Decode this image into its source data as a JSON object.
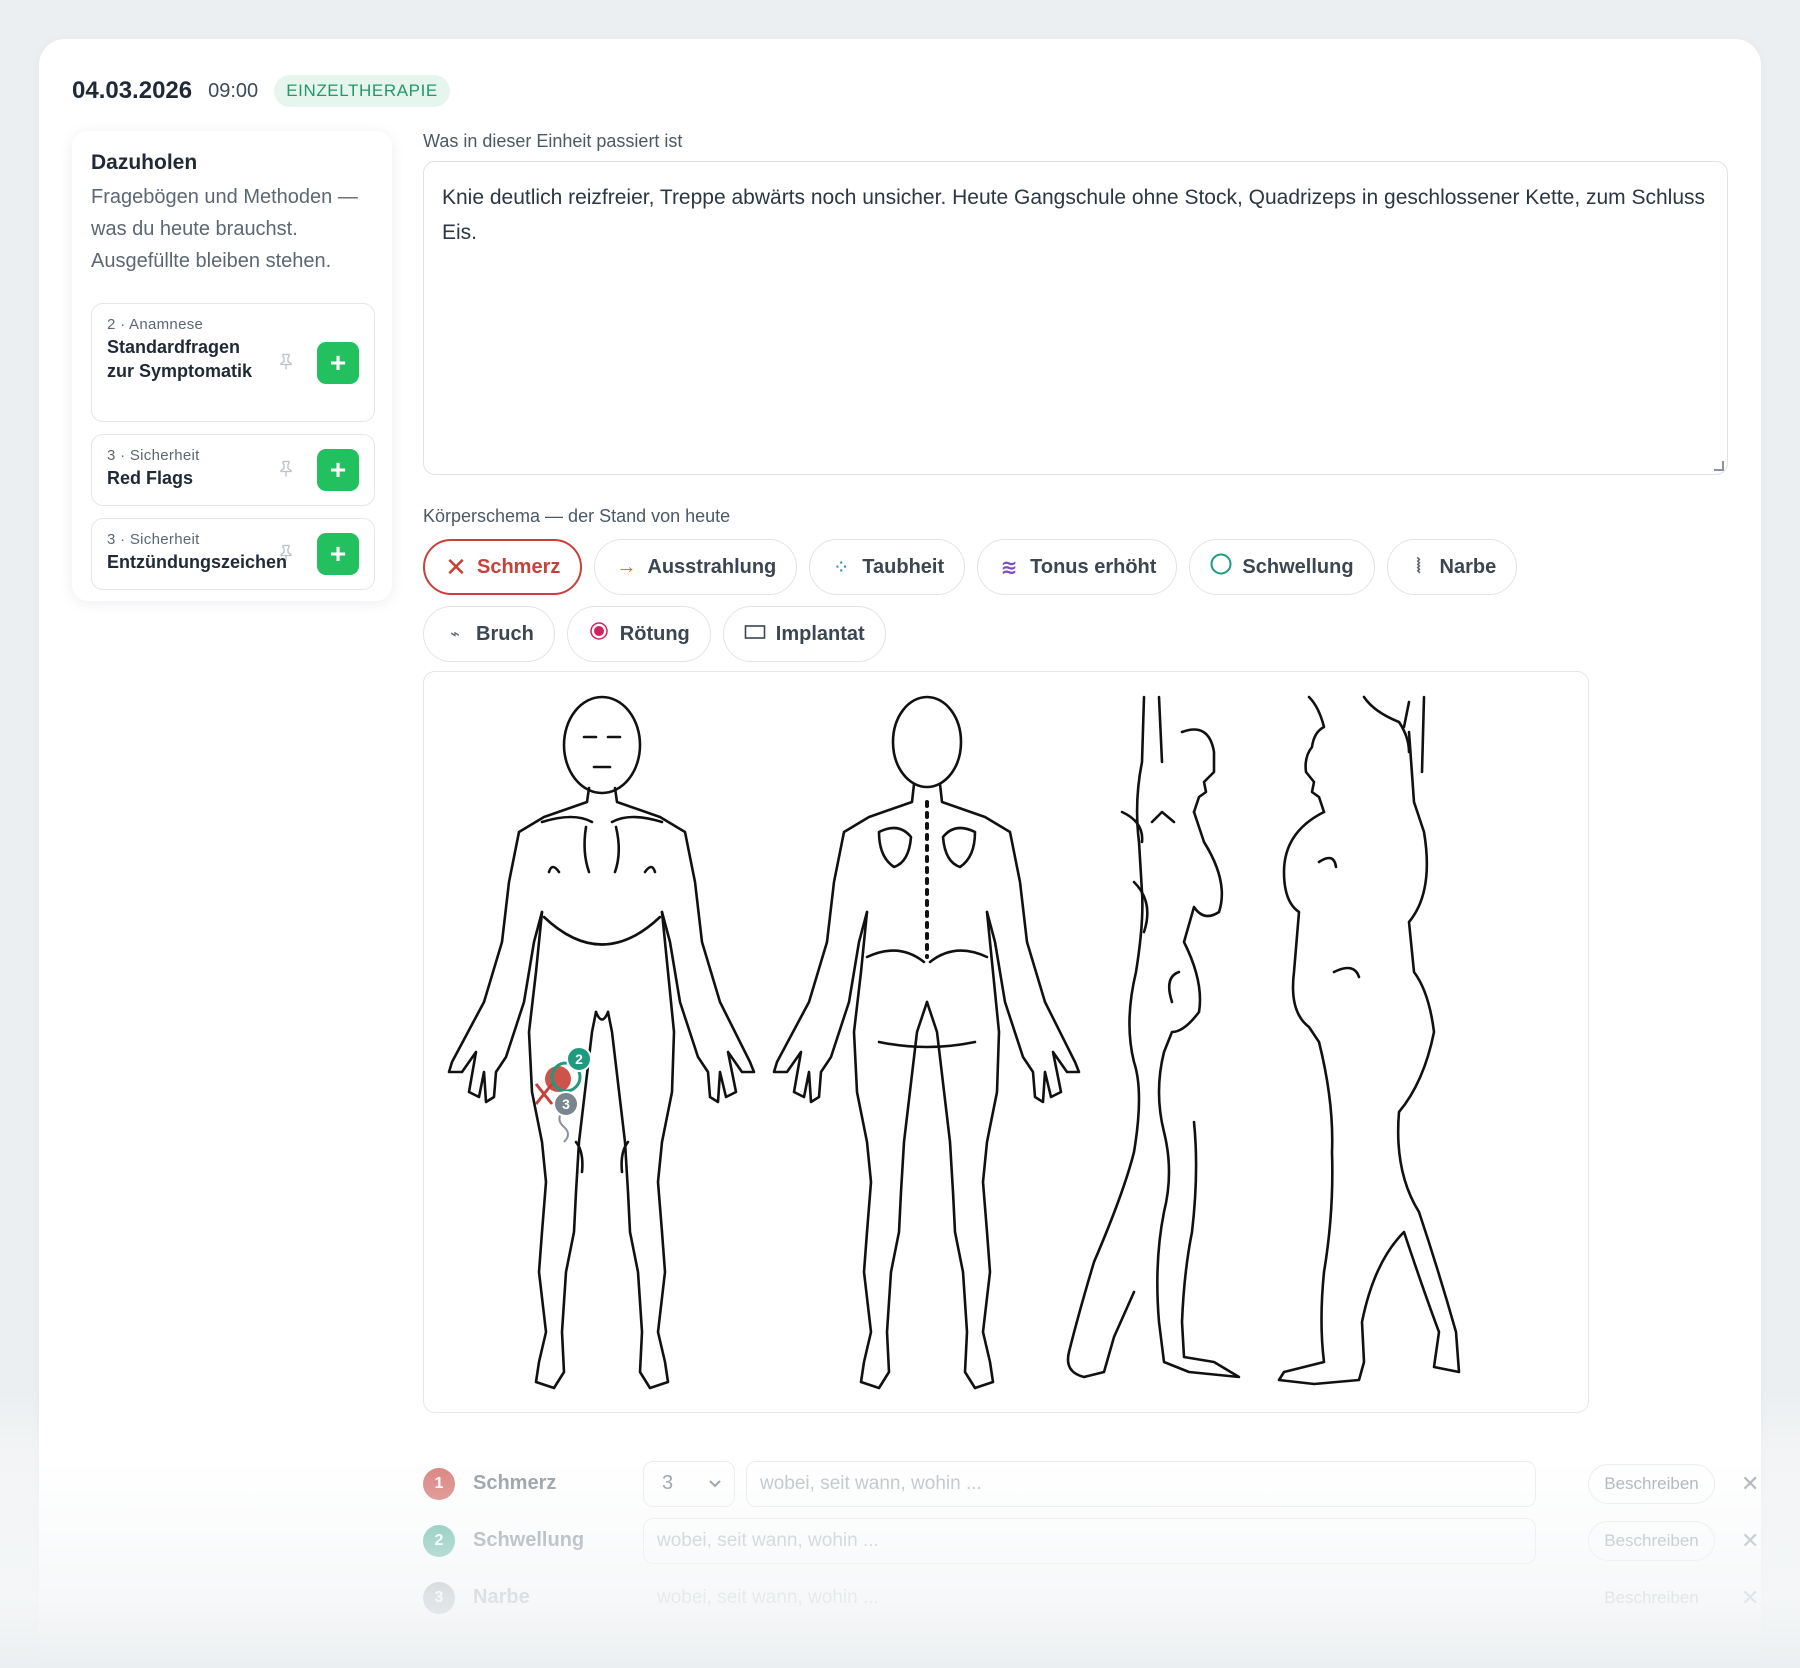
{
  "header": {
    "date": "04.03.2026",
    "time": "09:00",
    "badge": "EINZELTHERAPIE"
  },
  "sidebar": {
    "title": "Dazuholen",
    "description": "Fragebögen und Methoden — was du heute brauchst. Ausgefüllte bleiben stehen.",
    "items": [
      {
        "kicker": "2 · Anamnese",
        "title": "Standardfragen zur Symptomatik"
      },
      {
        "kicker": "3 · Sicherheit",
        "title": "Red Flags"
      },
      {
        "kicker": "3 · Sicherheit",
        "title": "Entzündungszeichen"
      }
    ]
  },
  "notes": {
    "label": "Was in dieser Einheit passiert ist",
    "text": "Knie deutlich reizfreier, Treppe abwärts noch unsicher. Heute Gangschule ohne Stock, Quadrizeps in geschlossener Kette, zum Schluss Eis."
  },
  "body_chart": {
    "label": "Körperschema — der Stand von heute",
    "tools": [
      {
        "label": "Schmerz",
        "icon": "x-icon",
        "active": true,
        "color": "#c7413a"
      },
      {
        "label": "Ausstrahlung",
        "icon": "arrow-right-icon",
        "color": "#d46b1f"
      },
      {
        "label": "Taubheit",
        "icon": "dots-icon",
        "color": "#2f8fbf"
      },
      {
        "label": "Tonus erhöht",
        "icon": "wave-icon",
        "color": "#7a4fbf"
      },
      {
        "label": "Schwellung",
        "icon": "circle-icon",
        "color": "#1f9a7e"
      },
      {
        "label": "Narbe",
        "icon": "scar-icon",
        "color": "#5b6772"
      },
      {
        "label": "Bruch",
        "icon": "break-icon",
        "color": "#5b6772"
      },
      {
        "label": "Rötung",
        "icon": "dot-icon",
        "color": "#d1245d"
      },
      {
        "label": "Implantat",
        "icon": "rect-icon",
        "color": "#3b4651"
      }
    ],
    "marker_badges": [
      "2",
      "3"
    ]
  },
  "markers": [
    {
      "num": "1",
      "name": "Schmerz",
      "intensity": "3",
      "placeholder": "wobei, seit wann, wohin ...",
      "button": "Beschreiben",
      "color": "#c7413a"
    },
    {
      "num": "2",
      "name": "Schwellung",
      "placeholder": "wobei, seit wann, wohin ...",
      "button": "Beschreiben",
      "color": "#1f9a7e"
    },
    {
      "num": "3",
      "name": "Narbe",
      "placeholder": "wobei, seit wann, wohin ...",
      "button": "Beschreiben",
      "color": "#6b757d"
    }
  ]
}
